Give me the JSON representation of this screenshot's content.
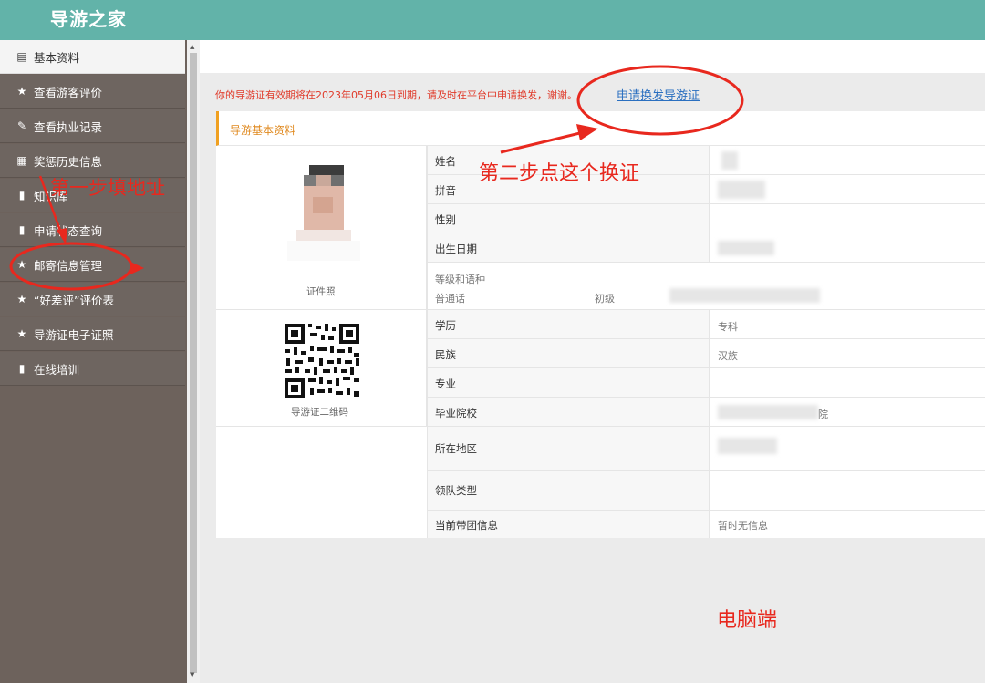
{
  "header": {
    "title": "导游之家"
  },
  "sidebar": {
    "items": [
      {
        "icon": "document-icon",
        "label": "基本资料"
      },
      {
        "icon": "star-icon",
        "label": "查看游客评价"
      },
      {
        "icon": "edit-icon",
        "label": "查看执业记录"
      },
      {
        "icon": "list-icon",
        "label": "奖惩历史信息"
      },
      {
        "icon": "book-icon",
        "label": "知识库"
      },
      {
        "icon": "book-icon",
        "label": "申请状态查询"
      },
      {
        "icon": "star-icon",
        "label": "邮寄信息管理"
      },
      {
        "icon": "star-icon",
        "label": "“好差评”评价表"
      },
      {
        "icon": "star-icon",
        "label": "导游证电子证照"
      },
      {
        "icon": "book-icon",
        "label": "在线培训"
      }
    ]
  },
  "notice": {
    "text": "你的导游证有效期将在2023年05月06日到期，请及时在平台中申请换发，谢谢。",
    "link": "申请换发导游证"
  },
  "panel": {
    "title": "导游基本资料",
    "photo_caption": "证件照",
    "qr_caption": "导游证二维码",
    "fields": {
      "name": "姓名",
      "pinyin": "拼音",
      "gender": "性别",
      "birth": "出生日期",
      "level_lang": "等级和语种",
      "language": "普通话",
      "level": "初级",
      "education": "学历",
      "education_value": "专科",
      "ethnicity": "民族",
      "ethnicity_value": "汉族",
      "major": "专业",
      "school": "毕业院校",
      "school_suffix": "院",
      "region": "所在地区",
      "lead_type": "领队类型",
      "current_group": "当前带团信息",
      "current_group_value": "暂时无信息"
    }
  },
  "annotations": {
    "step1": "第一步填地址",
    "step2": "第二步点这个换证",
    "pc": "电脑端"
  }
}
